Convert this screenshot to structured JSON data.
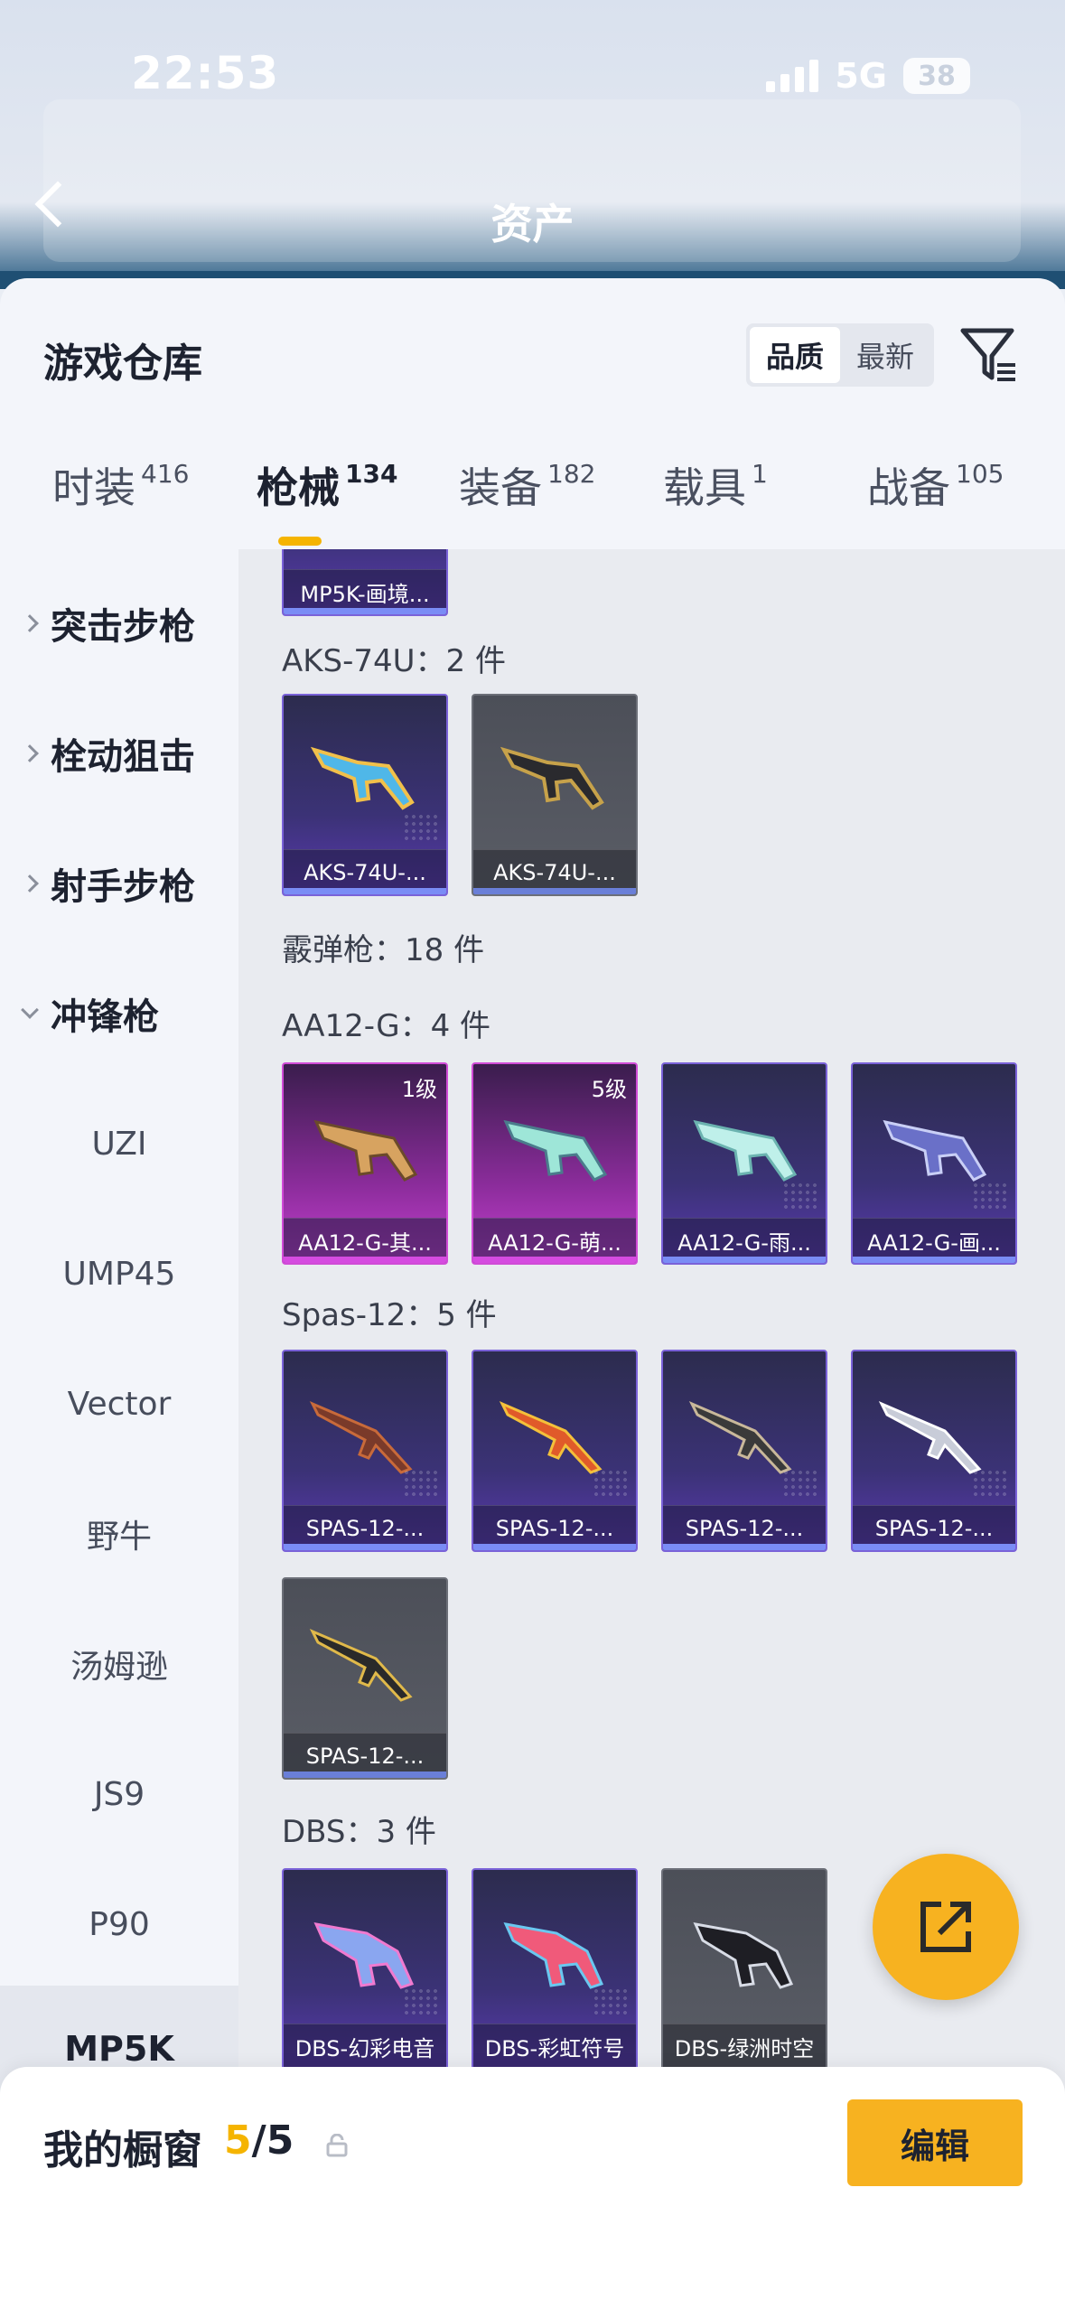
{
  "status_bar": {
    "time": "22:53",
    "network": "5G",
    "battery": "38"
  },
  "header": {
    "title": "资产"
  },
  "warehouse": {
    "title": "游戏仓库",
    "sort_options": [
      "品质",
      "最新"
    ],
    "active_sort": "品质"
  },
  "tabs": [
    {
      "label": "时装",
      "count": "416"
    },
    {
      "label": "枪械",
      "count": "134"
    },
    {
      "label": "装备",
      "count": "182"
    },
    {
      "label": "载具",
      "count": "1"
    },
    {
      "label": "战备",
      "count": "105"
    }
  ],
  "active_tab": "枪械",
  "sidebar": {
    "categories": [
      {
        "label": "突击步枪",
        "expanded": false
      },
      {
        "label": "栓动狙击",
        "expanded": false
      },
      {
        "label": "射手步枪",
        "expanded": false
      },
      {
        "label": "冲锋枪",
        "expanded": true
      }
    ],
    "subitems": [
      "UZI",
      "UMP45",
      "Vector",
      "野牛",
      "汤姆逊",
      "JS9",
      "P90",
      "MP5K"
    ],
    "active_subitem": "MP5K"
  },
  "content": {
    "top_partial_card": "MP5K-画境...",
    "groups": [
      {
        "title": "AKS-74U：2 件",
        "items": [
          {
            "name": "AKS-74U-...",
            "rarity": "purple",
            "level": ""
          },
          {
            "name": "AKS-74U-...",
            "rarity": "grey",
            "level": ""
          }
        ]
      },
      {
        "title": "霰弹枪：18 件",
        "items": []
      },
      {
        "title": "AA12-G：4 件",
        "items": [
          {
            "name": "AA12-G-其...",
            "rarity": "pink",
            "level": "1级"
          },
          {
            "name": "AA12-G-萌...",
            "rarity": "pink",
            "level": "5级"
          },
          {
            "name": "AA12-G-雨...",
            "rarity": "purple",
            "level": ""
          },
          {
            "name": "AA12-G-画...",
            "rarity": "purple",
            "level": ""
          }
        ]
      },
      {
        "title": "Spas-12：5 件",
        "items": [
          {
            "name": "SPAS-12-...",
            "rarity": "purple",
            "level": ""
          },
          {
            "name": "SPAS-12-...",
            "rarity": "purple",
            "level": ""
          },
          {
            "name": "SPAS-12-...",
            "rarity": "purple",
            "level": ""
          },
          {
            "name": "SPAS-12-...",
            "rarity": "purple",
            "level": ""
          },
          {
            "name": "SPAS-12-...",
            "rarity": "grey",
            "level": ""
          }
        ]
      },
      {
        "title": "DBS：3 件",
        "items": [
          {
            "name": "DBS-幻彩电音",
            "rarity": "purple",
            "level": ""
          },
          {
            "name": "DBS-彩虹符号",
            "rarity": "purple",
            "level": ""
          },
          {
            "name": "DBS-绿洲时空",
            "rarity": "grey",
            "level": ""
          }
        ]
      }
    ]
  },
  "showcase": {
    "label": "我的橱窗",
    "current": "5",
    "total": "/5",
    "edit_label": "编辑"
  },
  "colors": {
    "accent": "#f7b220",
    "tab_indicator": "#f5b400"
  }
}
